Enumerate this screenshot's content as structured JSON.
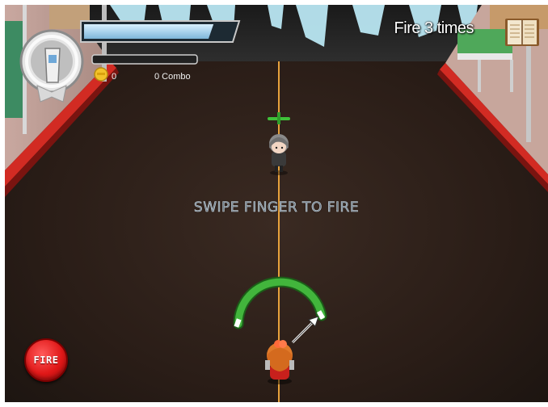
{
  "hud": {
    "objective": "Fire 3 times",
    "coins": "0",
    "combo": "0 Combo",
    "health_level": 0.88,
    "energy_level": 0.0
  },
  "instruction": "SWIPE FINGER TO FIRE",
  "controls": {
    "fire_label": "FIRE",
    "aim_arc": "aim-power-arc"
  },
  "icons": {
    "portrait_frame": "ring-portrait-icon",
    "coin": "coin-icon",
    "journal": "book-icon",
    "target_marker": "target-marker-icon"
  },
  "colors": {
    "road": "#2a1e18",
    "curb_red": "#d02a24",
    "aim_line": "#e8a23c",
    "aim_arc": "#3fb13a",
    "fire_button": "#e01818"
  }
}
